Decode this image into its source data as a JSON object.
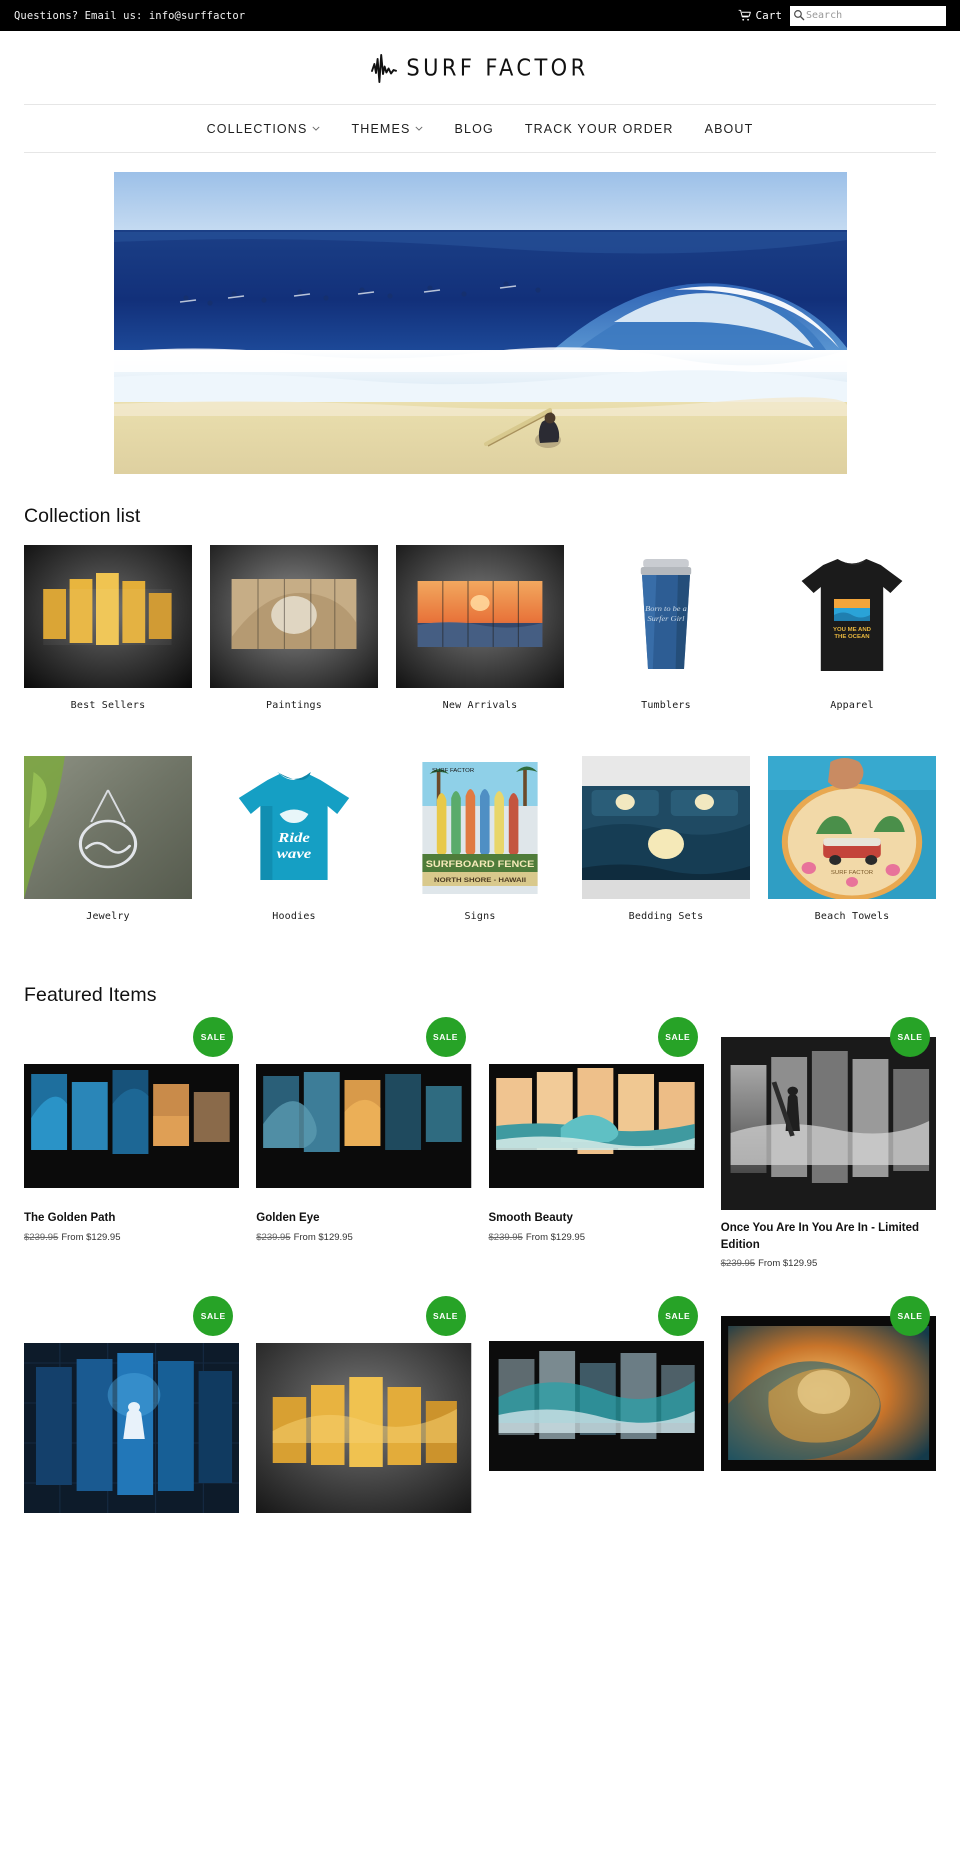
{
  "topbar": {
    "email_text": "Questions? Email us: info@surffactor",
    "cart_label": "Cart",
    "search_placeholder": "Search",
    "search_value": "",
    "background": "#000000"
  },
  "logo": {
    "text": "SURF FACTOR"
  },
  "nav": {
    "items": [
      {
        "label": "COLLECTIONS",
        "has_caret": true
      },
      {
        "label": "THEMES",
        "has_caret": true
      },
      {
        "label": "BLOG",
        "has_caret": false
      },
      {
        "label": "TRACK YOUR ORDER",
        "has_caret": false
      },
      {
        "label": "ABOUT",
        "has_caret": false
      }
    ]
  },
  "hero": {
    "alt": "Surfers waiting on a large breaking ocean wave with a person sitting beside a surfboard on the sand"
  },
  "collection_list": {
    "title": "Collection list",
    "row1": [
      {
        "label": "Best Sellers"
      },
      {
        "label": "Paintings"
      },
      {
        "label": "New Arrivals"
      },
      {
        "label": "Tumblers"
      },
      {
        "label": "Apparel"
      }
    ],
    "row2": [
      {
        "label": "Jewelry"
      },
      {
        "label": "Hoodies"
      },
      {
        "label": "Signs"
      },
      {
        "label": "Bedding Sets"
      },
      {
        "label": "Beach Towels"
      }
    ]
  },
  "featured": {
    "title": "Featured Items",
    "sale_badge": "SALE",
    "badge_color": "#27a327",
    "row1": [
      {
        "title": "The Golden Path",
        "was_price": "$239.95",
        "price": "From $129.95"
      },
      {
        "title": "Golden Eye",
        "was_price": "$239.95",
        "price": "From $129.95"
      },
      {
        "title": "Smooth Beauty",
        "was_price": "$239.95",
        "price": "From $129.95"
      },
      {
        "title": "Once You Are In You Are In - Limited Edition",
        "was_price": "$239.95",
        "price": "From $129.95"
      }
    ],
    "row2": [
      {
        "title": "",
        "was_price": "",
        "price": ""
      },
      {
        "title": "",
        "was_price": "",
        "price": ""
      },
      {
        "title": "",
        "was_price": "",
        "price": ""
      },
      {
        "title": "",
        "was_price": "",
        "price": ""
      }
    ]
  }
}
